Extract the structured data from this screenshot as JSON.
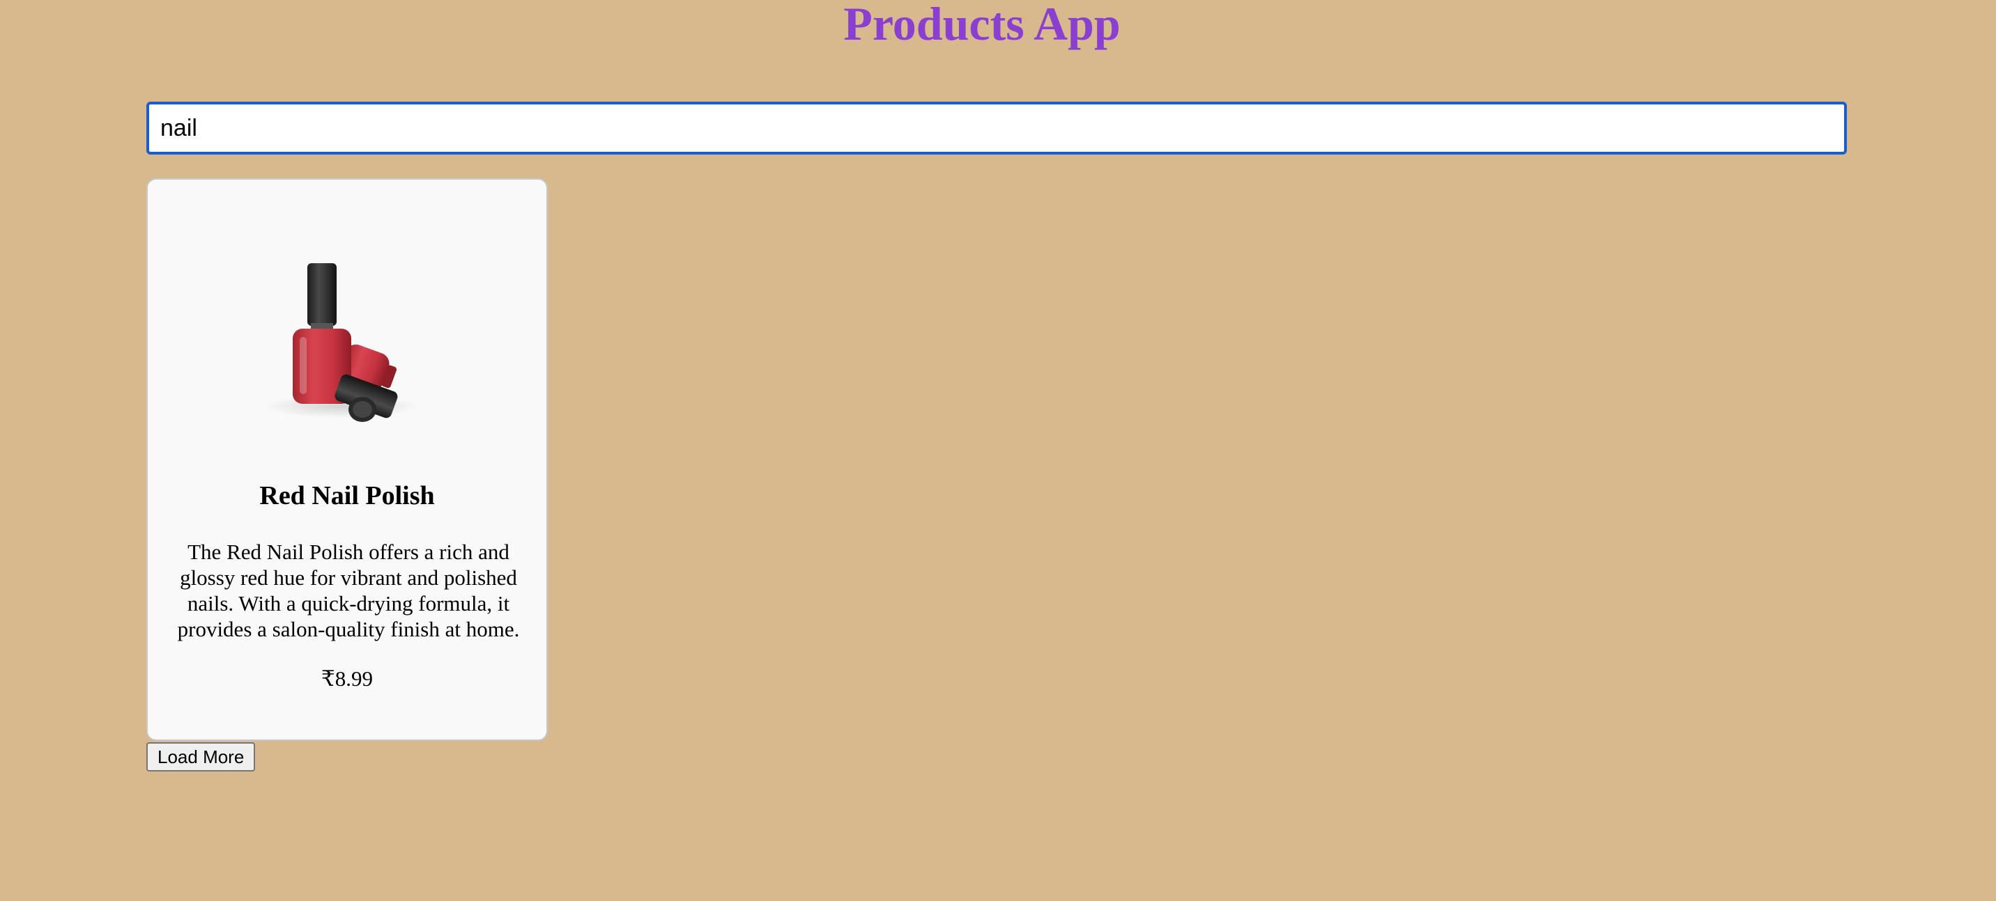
{
  "app": {
    "title": "Products App"
  },
  "search": {
    "value": "nail"
  },
  "products": [
    {
      "title": "Red Nail Polish",
      "description": "The Red Nail Polish offers a rich and glossy red hue for vibrant and polished nails. With a quick-drying formula, it provides a salon-quality finish at home.",
      "price": "₹8.99",
      "image_icon": "nail-polish-bottles-icon"
    }
  ],
  "actions": {
    "load_more_label": "Load More"
  },
  "colors": {
    "background": "#d8b88d",
    "title": "#8a3fd1",
    "focus_border": "#1a5fc8",
    "polish_red": "#c8323e"
  }
}
